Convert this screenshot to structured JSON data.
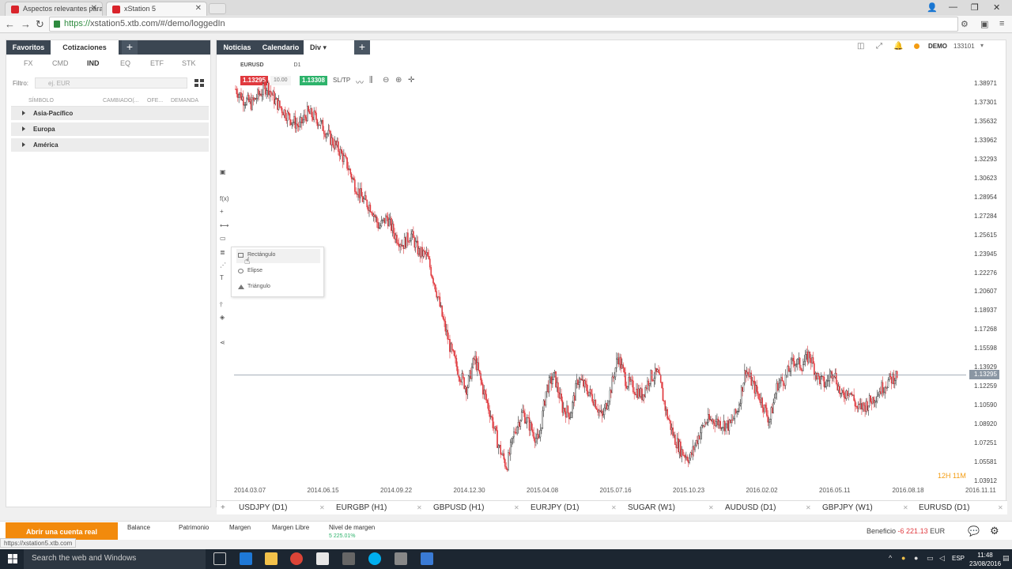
{
  "browser": {
    "tabs": [
      {
        "title": "Aspectos relevantes para"
      },
      {
        "title": "xStation 5"
      }
    ],
    "url_scheme": "https://",
    "url_rest": "xstation5.xtb.com/#/demo/loggedIn"
  },
  "left_panel": {
    "tabs": [
      "Favoritos",
      "Cotizaciones"
    ],
    "categories": [
      "FX",
      "CMD",
      "IND",
      "EQ",
      "ETF",
      "STK"
    ],
    "filter_label": "Filtro:",
    "filter_placeholder": "ej. EUR",
    "columns": [
      "SÍMBOLO",
      "CAMBIADO(...",
      "OFE...",
      "DEMANDA"
    ],
    "regions": [
      "Asia-Pacífico",
      "Europa",
      "América"
    ]
  },
  "main_tabs": [
    "Noticias",
    "Calendario",
    "Div"
  ],
  "account": {
    "mode": "DEMO",
    "number": "133101"
  },
  "chart_toolbar": {
    "symbol": "EURUSD",
    "timeframe": "D1",
    "sell_price": "1.13295",
    "volume": "10.00",
    "buy_price": "1.13308",
    "sltp": "SL/TP"
  },
  "drawing_menu": [
    "Rectángulo",
    "Elipse",
    "Triángulo"
  ],
  "colors": {
    "sell": "#e0393e",
    "buy": "#2db36b",
    "accent": "#f28a0c",
    "panel_dark": "#3b4652"
  },
  "chart_data": {
    "type": "candlestick",
    "symbol": "EURUSD",
    "timeframe": "D1",
    "last_price": "1.13295",
    "y_ticks": [
      "1.38971",
      "1.37301",
      "1.35632",
      "1.33962",
      "1.32293",
      "1.30623",
      "1.28954",
      "1.27284",
      "1.25615",
      "1.23945",
      "1.22276",
      "1.20607",
      "1.18937",
      "1.17268",
      "1.15598",
      "1.13929",
      "1.12259",
      "1.10590",
      "1.08920",
      "1.07251",
      "1.05581",
      "1.03912"
    ],
    "x_ticks": [
      "2014.03.07",
      "2014.06.15",
      "2014.09.22",
      "2014.12.30",
      "2015.04.08",
      "2015.07.16",
      "2015.10.23",
      "2016.02.02",
      "2016.05.11",
      "2016.08.18",
      "2016.11.11"
    ],
    "ylim": [
      1.03912,
      1.38971
    ],
    "series": [
      {
        "values": [
          1.385,
          1.376,
          1.372,
          1.381,
          1.388,
          1.374,
          1.366,
          1.358,
          1.352,
          1.364,
          1.36,
          1.351,
          1.34,
          1.331,
          1.318,
          1.3,
          1.287,
          1.281,
          1.263,
          1.272,
          1.256,
          1.248,
          1.257,
          1.241,
          1.238,
          1.213,
          1.182,
          1.155,
          1.135,
          1.121,
          1.148,
          1.121,
          1.098,
          1.07,
          1.052,
          1.083,
          1.1,
          1.087,
          1.073,
          1.121,
          1.132,
          1.104,
          1.098,
          1.13,
          1.121,
          1.111,
          1.095,
          1.118,
          1.15,
          1.127,
          1.121,
          1.115,
          1.131,
          1.134,
          1.101,
          1.078,
          1.065,
          1.059,
          1.078,
          1.092,
          1.093,
          1.09,
          1.088,
          1.102,
          1.138,
          1.123,
          1.11,
          1.092,
          1.125,
          1.13,
          1.146,
          1.141,
          1.151,
          1.131,
          1.124,
          1.138,
          1.113,
          1.121,
          1.103,
          1.106,
          1.112,
          1.121,
          1.128,
          1.133
        ]
      }
    ]
  },
  "countdown": "12H 11M",
  "bottom_tabs": [
    "USDJPY (D1)",
    "EURGBP (H1)",
    "GBPUSD (H1)",
    "EURJPY (D1)",
    "SUGAR (W1)",
    "AUDUSD (D1)",
    "GBPJPY (W1)",
    "EURUSD (D1)"
  ],
  "status": {
    "open_account": "Abrir una cuenta real",
    "items": [
      "Balance",
      "Patrimonio",
      "Margen",
      "Margen Libre",
      "Nivel de margen"
    ],
    "margin_level_value": "5 225.01%",
    "profit_label": "Beneficio",
    "profit_value": "-6 221.13",
    "profit_currency": "EUR"
  },
  "url_hint": "https://xstation5.xtb.com",
  "taskbar": {
    "search": "Search the web and Windows",
    "lang": "ESP",
    "time": "11:48",
    "date": "23/08/2016"
  }
}
